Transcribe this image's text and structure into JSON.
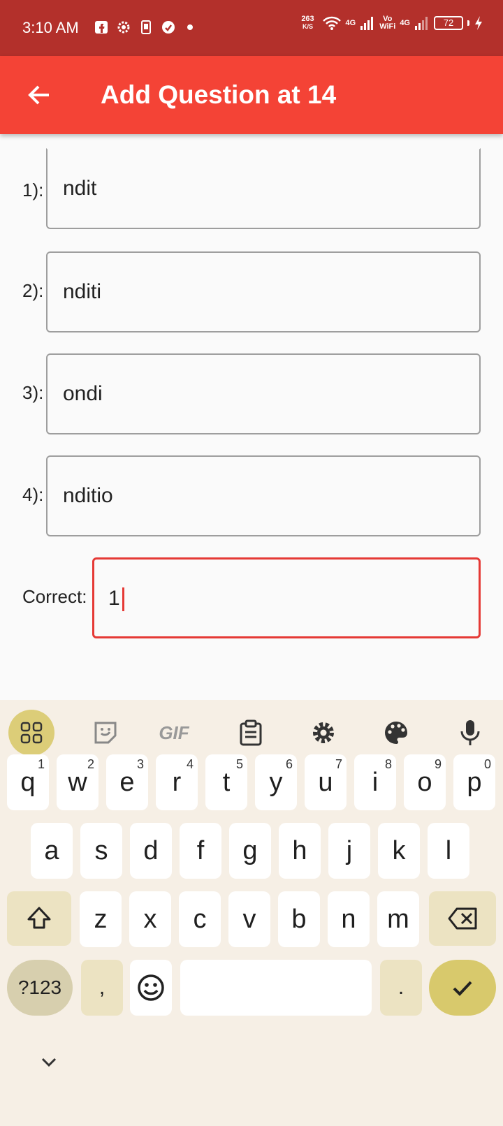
{
  "status_bar": {
    "time": "3:10 AM",
    "speed_value": "263",
    "speed_unit": "K/S",
    "net1": "4G",
    "vowifi_top": "Vo",
    "vowifi_bottom": "WiFi",
    "net2": "4G",
    "battery": "72"
  },
  "app_bar": {
    "title": "Add Question at 14",
    "back_icon": "arrow-back-icon"
  },
  "form": {
    "options": [
      {
        "label": "1):",
        "value": "ndit"
      },
      {
        "label": "2):",
        "value": "nditi"
      },
      {
        "label": "3):",
        "value": "ondi"
      },
      {
        "label": "4):",
        "value": "nditio"
      }
    ],
    "correct_label": "Correct:",
    "correct_value": "1"
  },
  "keyboard": {
    "toolbar": [
      "apps-grid-icon",
      "sticker-icon",
      "gif-icon",
      "clipboard-icon",
      "settings-icon",
      "palette-icon",
      "microphone-icon"
    ],
    "gif_label": "GIF",
    "row1": [
      {
        "key": "q",
        "hint": "1"
      },
      {
        "key": "w",
        "hint": "2"
      },
      {
        "key": "e",
        "hint": "3"
      },
      {
        "key": "r",
        "hint": "4"
      },
      {
        "key": "t",
        "hint": "5"
      },
      {
        "key": "y",
        "hint": "6"
      },
      {
        "key": "u",
        "hint": "7"
      },
      {
        "key": "i",
        "hint": "8"
      },
      {
        "key": "o",
        "hint": "9"
      },
      {
        "key": "p",
        "hint": "0"
      }
    ],
    "row2": [
      "a",
      "s",
      "d",
      "f",
      "g",
      "h",
      "j",
      "k",
      "l"
    ],
    "row3": [
      "z",
      "x",
      "c",
      "v",
      "b",
      "n",
      "m"
    ],
    "symbols_label": "?123",
    "comma": ",",
    "period": ".",
    "accent_color": "#dccd78"
  }
}
